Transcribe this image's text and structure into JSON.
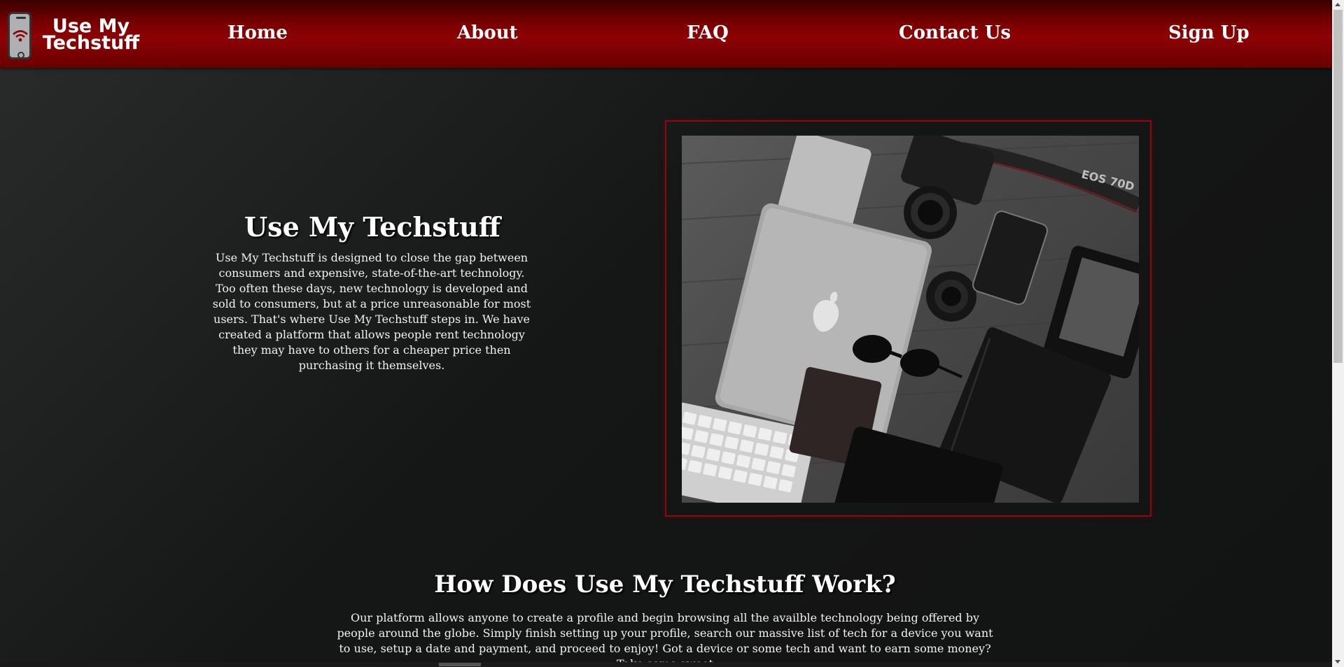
{
  "brand": {
    "line1": "Use My",
    "line2": "Techstuff"
  },
  "nav": {
    "home": "Home",
    "about": "About",
    "faq": "FAQ",
    "contact": "Contact Us",
    "signup": "Sign Up"
  },
  "hero": {
    "title": "Use My Techstuff",
    "text": "Use My Techstuff is designed to close the gap between consumers and expensive, state-of-the-art technology. Too often these days, new technology is developed and sold to consumers, but at a price unreasonable for most users. That's where Use My Techstuff steps in. We have created a platform that allows people rent technology they may have to others for a cheaper price then purchasing it themselves.",
    "image_label": "EOS 70D"
  },
  "how": {
    "title": "How Does Use My Techstuff Work?",
    "text": "Our platform allows anyone to create a profile and begin browsing all the availble technology being offered by people around the globe. Simply finish setting up your profile, search our massive list of tech for a device you want to use, setup a date and payment, and proceed to enjoy! Got a device or some tech and want to earn some money? Take some sweet"
  },
  "colors": {
    "header": "#8d0204",
    "frame": "#8a0a12",
    "background": "#151616"
  },
  "icons": {
    "logo": "phone-wifi-icon"
  }
}
